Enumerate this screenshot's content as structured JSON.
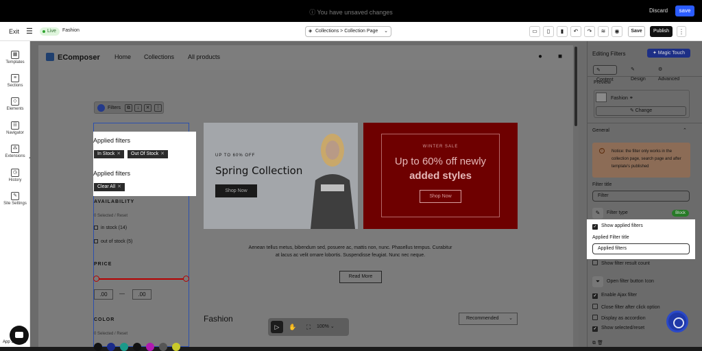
{
  "topbar": {
    "unsaved": "ⓘ You have unsaved changes",
    "discard": "Discard",
    "save": "save"
  },
  "toolbar": {
    "exit": "Exit",
    "live": "Live",
    "page_name": "Fashion",
    "breadcrumb": "Collections  >  Collection Page",
    "save": "Save",
    "publish": "Publish"
  },
  "leftbar": {
    "items": [
      "Templates",
      "Sections",
      "Elements",
      "Navigator",
      "Extensions",
      "History",
      "Site Settings"
    ]
  },
  "store": {
    "logo": "EComposer",
    "nav": [
      "Home",
      "Collections",
      "All products"
    ]
  },
  "filter_toolbar": {
    "label": "Filters"
  },
  "applied": {
    "title1": "Applied filters",
    "chips": [
      "In Stock",
      "Out Of Stock"
    ],
    "title2": "Applied filters",
    "clear": "Clear All"
  },
  "filters": {
    "availability": "AVAILABILITY",
    "avail_selected": "0 Selected   /   Reset",
    "in_stock": "in stock (14)",
    "out_stock": "out of stock (5)",
    "price": "PRICE",
    "price_min": ".00",
    "price_dash": "—",
    "price_max": ".00",
    "color": "COLOR",
    "color_selected": "0 Selected   /   Reset"
  },
  "banner_left": {
    "upto": "UP TO 60% OFF",
    "title": "Spring Collection",
    "shop": "Shop Now"
  },
  "banner_right": {
    "winter": "WINTER SALE",
    "big1": "Up to 60% off newly",
    "big2": "added styles",
    "shop": "Shop Now"
  },
  "content": {
    "paragraph": "Aenean tellus metus, bibendum sed, posuere ac, mattis non, nunc. Phasellus tempus. Curabitur at lacus ac velit ornare lobortis. Suspendisse feugiat. Nunc nec neque.",
    "read_more": "Read More",
    "fashion": "Fashion",
    "sort": "Recommended"
  },
  "bottom_tools": {
    "zoom": "100%"
  },
  "app_settings": "App Settings",
  "panel": {
    "title": "Editing Filters",
    "magic": "✦ Magic Touch",
    "tabs": [
      "Content",
      "Design",
      "Advanced"
    ],
    "preview_label": "Preview",
    "preview_name": "Fashion",
    "change": "Change",
    "general": "General",
    "notice": "Notice: the filter only works in the collection page, search page and after template's published",
    "filter_title_label": "Filter title",
    "filter_title_value": "Filter",
    "filter_type": "Filter type",
    "filter_type_value": "Block",
    "show_applied": "Show applied filters",
    "applied_title_label": "Applied Filter title",
    "applied_title_value": "Applied filters",
    "show_count": "Show filter result count",
    "open_icon": "Open filter button Icon",
    "enable_ajax": "Enable Ajax filter",
    "close_after": "Close filter after click option",
    "accordion": "Display as accordion",
    "show_selected": "Show selected/reset"
  },
  "colors": {
    "accent": "#2b5cff",
    "banner_red": "#b40000",
    "swatches": [
      "#111111",
      "#1a2a8a",
      "#1a9a8a",
      "#111111",
      "#b01ab0",
      "#555555",
      "#c9c92a"
    ]
  }
}
